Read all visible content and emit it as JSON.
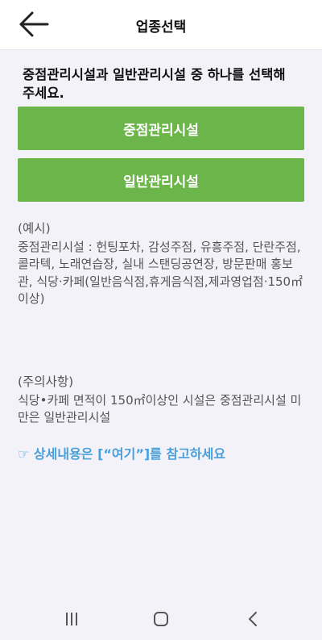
{
  "header": {
    "title": "업종선택",
    "back_icon": "arrow-left-icon"
  },
  "instruction": "중점관리시설과 일반관리시설 중 하나를 선택해 주세요.",
  "buttons": {
    "primary": "중점관리시설",
    "secondary": "일반관리시설",
    "color": "#6bb54a"
  },
  "examples": {
    "heading": "(예시)",
    "body": "중점관리시설 : 헌팅포차, 감성주점, 유흥주점, 단란주점, 콜라텍, 노래연습장, 실내 스탠딩공연장, 방문판매 홍보관, 식당·카페(일반음식점,휴게음식점,제과영업점·150㎡이상)"
  },
  "notes": {
    "heading": "(주의사항)",
    "body": "식당•카페 면적이 150㎡이상인 시설은 중점관리시설 미만은 일반관리시설"
  },
  "link": {
    "text": "☞ 상세내용은 [“여기”]를 참고하세요",
    "color": "#4a9fda"
  },
  "navbar": {
    "recents_icon": "recents-icon",
    "home_icon": "home-icon",
    "back_icon": "nav-back-icon"
  }
}
